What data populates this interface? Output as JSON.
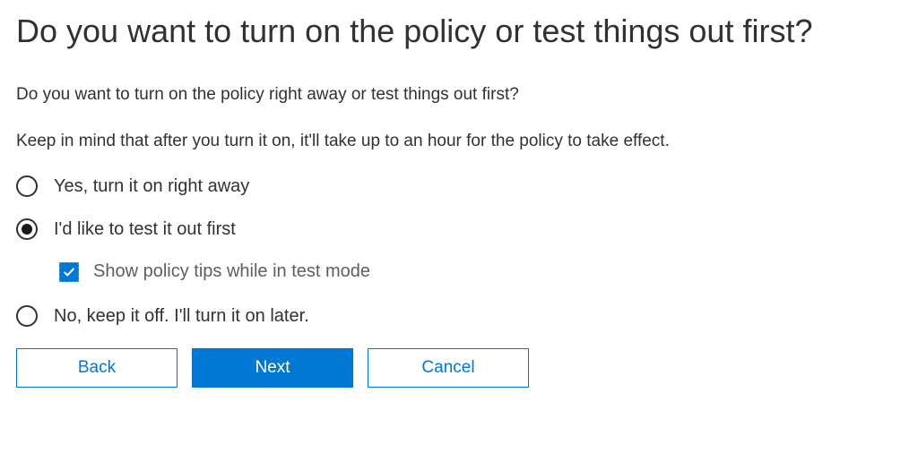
{
  "title": "Do you want to turn on the policy or test things out first?",
  "description1": "Do you want to turn on the policy right away or test things out first?",
  "description2": "Keep in mind that after you turn it on, it'll take up to an hour for the policy to take effect.",
  "options": {
    "on_now": {
      "label": "Yes, turn it on right away",
      "selected": false
    },
    "test_first": {
      "label": "I'd like to test it out first",
      "selected": true,
      "show_tips": {
        "label": "Show policy tips while in test mode",
        "checked": true
      }
    },
    "keep_off": {
      "label": "No, keep it off. I'll turn it on later.",
      "selected": false
    }
  },
  "buttons": {
    "back": "Back",
    "next": "Next",
    "cancel": "Cancel"
  },
  "colors": {
    "primary": "#0078d4",
    "text": "#323130",
    "muted": "#605e5c"
  }
}
